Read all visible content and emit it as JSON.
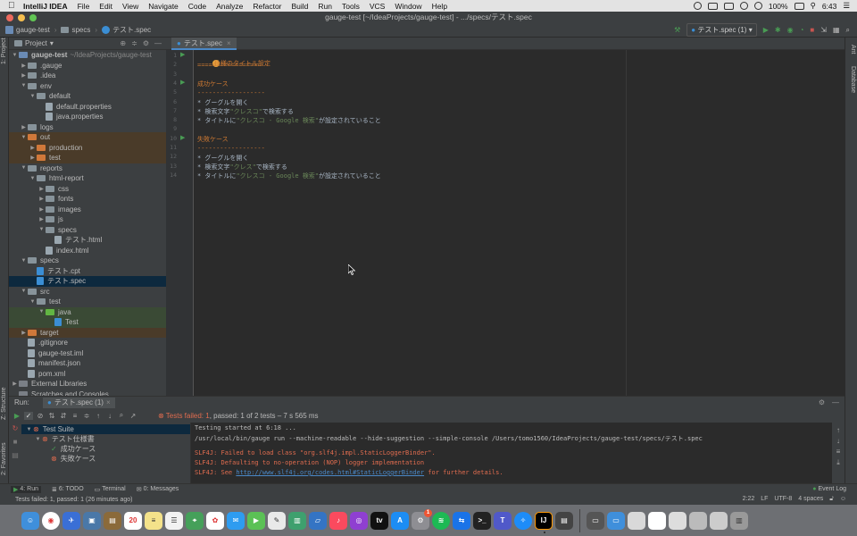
{
  "menubar": {
    "app": "IntelliJ IDEA",
    "items": [
      "File",
      "Edit",
      "View",
      "Navigate",
      "Code",
      "Analyze",
      "Refactor",
      "Build",
      "Run",
      "Tools",
      "VCS",
      "Window",
      "Help"
    ],
    "battery": "100%",
    "time": "6:43"
  },
  "window": {
    "title": "gauge-test [~/IdeaProjects/gauge-test] - .../specs/テスト.spec"
  },
  "navbar": {
    "crumbs": [
      "gauge-test",
      "specs",
      "テスト.spec"
    ],
    "run_config": "テスト.spec (1)"
  },
  "strips": {
    "project": "1: Project",
    "structure": "Z: Structure",
    "favorites": "2: Favorites",
    "ant": "Ant",
    "database": "Database"
  },
  "project": {
    "header": "Project",
    "tree": [
      {
        "label": "gauge-test",
        "extra": "~/IdeaProjects/gauge-test",
        "kind": "module"
      },
      {
        "label": ".gauge",
        "kind": "folder"
      },
      {
        "label": ".idea",
        "kind": "folder"
      },
      {
        "label": "env",
        "kind": "folder"
      },
      {
        "label": "default",
        "kind": "folder"
      },
      {
        "label": "default.properties",
        "kind": "file"
      },
      {
        "label": "java.properties",
        "kind": "file"
      },
      {
        "label": "logs",
        "kind": "folder"
      },
      {
        "label": "out",
        "kind": "folder-out"
      },
      {
        "label": "production",
        "kind": "folder-out"
      },
      {
        "label": "test",
        "kind": "folder-out"
      },
      {
        "label": "reports",
        "kind": "folder"
      },
      {
        "label": "html-report",
        "kind": "folder"
      },
      {
        "label": "css",
        "kind": "folder"
      },
      {
        "label": "fonts",
        "kind": "folder"
      },
      {
        "label": "images",
        "kind": "folder"
      },
      {
        "label": "js",
        "kind": "folder"
      },
      {
        "label": "specs",
        "kind": "folder"
      },
      {
        "label": "テスト.html",
        "kind": "file"
      },
      {
        "label": "index.html",
        "kind": "file"
      },
      {
        "label": "specs",
        "kind": "folder"
      },
      {
        "label": "テスト.cpt",
        "kind": "spec"
      },
      {
        "label": "テスト.spec",
        "kind": "spec"
      },
      {
        "label": "src",
        "kind": "folder"
      },
      {
        "label": "test",
        "kind": "folder"
      },
      {
        "label": "java",
        "kind": "folder-test"
      },
      {
        "label": "Test",
        "kind": "class"
      },
      {
        "label": "target",
        "kind": "folder-out"
      },
      {
        "label": ".gitignore",
        "kind": "file"
      },
      {
        "label": "gauge-test.iml",
        "kind": "file"
      },
      {
        "label": "manifest.json",
        "kind": "file"
      },
      {
        "label": "pom.xml",
        "kind": "file"
      },
      {
        "label": "External Libraries",
        "kind": "lib"
      },
      {
        "label": "Scratches and Consoles",
        "kind": "lib"
      }
    ]
  },
  "editor": {
    "tab": "テスト.spec",
    "line_numbers": [
      "1",
      "2",
      "3",
      "4",
      "5",
      "6",
      "7",
      "8",
      "9",
      "10",
      "11",
      "12",
      "13",
      "14"
    ],
    "lines": {
      "l1": "仕様のタイトル設定",
      "l2": "=================",
      "l4": "成功ケース",
      "l5": "------------------",
      "l6": "* グーグルを開く",
      "l7a": "* 検索文字",
      "l7b": "\"クレスコ\"",
      "l7c": "で検索する",
      "l8a": "* タイトルに",
      "l8b": "\"クレスコ - Google 検索\"",
      "l8c": "が設定されていること",
      "l10": "失敗ケース",
      "l11": "------------------",
      "l12": "* グーグルを開く",
      "l13a": "* 検索文字",
      "l13b": "\"クレス\"",
      "l13c": "で検索する",
      "l14a": "* タイトルに",
      "l14b": "\"クレスコ - Google 検索\"",
      "l14c": "が設定されていること"
    }
  },
  "run": {
    "label": "Run:",
    "tab": "テスト.spec (1)",
    "status_fail": "Tests failed: 1",
    "status_rest": ", passed: 1 of 2 tests – 7 s 565 ms",
    "tree": [
      {
        "label": "Test Suite",
        "state": "fail"
      },
      {
        "label": "テスト仕様書",
        "state": "fail"
      },
      {
        "label": "成功ケース",
        "state": "pass"
      },
      {
        "label": "失敗ケース",
        "state": "fail"
      }
    ],
    "console": {
      "c1": "Testing started at 6:18 ...",
      "c2": "/usr/local/bin/gauge run --machine-readable --hide-suggestion --simple-console /Users/tomo1560/IdeaProjects/gauge-test/specs/テスト.spec",
      "c3": "SLF4J: Failed to load class \"org.slf4j.impl.StaticLoggerBinder\".",
      "c4": "SLF4J: Defaulting to no-operation (NOP) logger implementation",
      "c5a": "SLF4J: See ",
      "c5b": "http://www.slf4j.org/codes.html#StaticLoggerBinder",
      "c5c": " for further details."
    }
  },
  "bottom_tabs": {
    "run": "4: Run",
    "todo": "6: TODO",
    "terminal": "Terminal",
    "messages": "0: Messages",
    "event_log": "Event Log"
  },
  "statusbar": {
    "message": "Tests failed: 1, passed: 1 (26 minutes ago)",
    "position": "2:22",
    "line_sep": "LF",
    "encoding": "UTF-8",
    "indent": "4 spaces"
  },
  "dock": {
    "calendar_day": "20",
    "badge": "1"
  },
  "colors": {
    "accent": "#4a88c7",
    "fail": "#e06c4f",
    "pass": "#499c54",
    "spec_heading": "#cc7832",
    "string": "#6a8759"
  }
}
